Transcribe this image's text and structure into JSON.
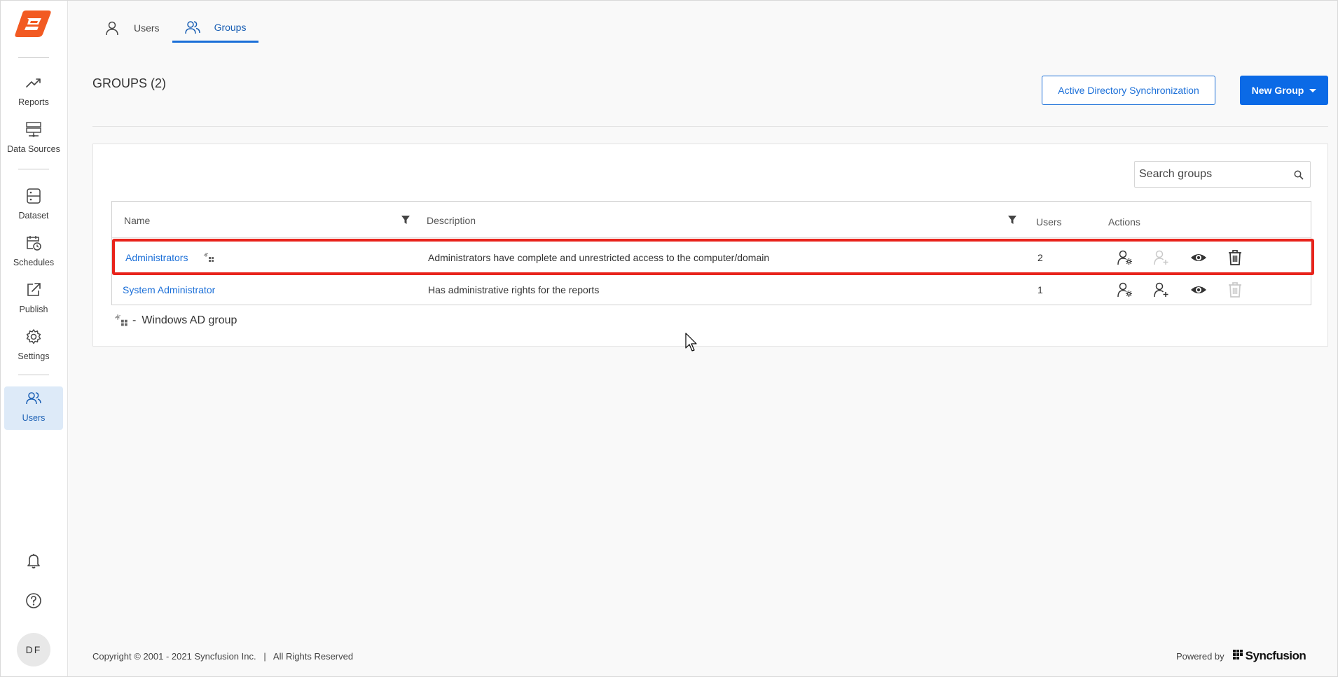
{
  "sidebar": {
    "items": [
      {
        "label": "Reports",
        "icon": "trend-icon"
      },
      {
        "label": "Data Sources",
        "icon": "database-icon"
      },
      {
        "label": "Dataset",
        "icon": "dataset-icon"
      },
      {
        "label": "Schedules",
        "icon": "calendar-clock-icon"
      },
      {
        "label": "Publish",
        "icon": "publish-icon"
      },
      {
        "label": "Settings",
        "icon": "gear-icon"
      },
      {
        "label": "Users",
        "icon": "users-icon",
        "active": true
      }
    ],
    "avatar_initials": "DF"
  },
  "tabs": [
    {
      "label": "Users",
      "icon": "user-icon"
    },
    {
      "label": "Groups",
      "icon": "groups-icon",
      "active": true
    }
  ],
  "page": {
    "title": "GROUPS (2)"
  },
  "buttons": {
    "ad_sync": "Active Directory Synchronization",
    "new_group": "New Group"
  },
  "search": {
    "placeholder": "Search groups"
  },
  "grid": {
    "columns": [
      "Name",
      "Description",
      "Users",
      "Actions"
    ],
    "rows": [
      {
        "name": "Administrators",
        "windows_ad": true,
        "description": "Administrators have complete and unrestricted access to the computer/domain",
        "users": "2",
        "add_user_enabled": false,
        "delete_enabled": true
      },
      {
        "name": "System Administrator",
        "windows_ad": false,
        "description": "Has administrative rights for the reports",
        "users": "1",
        "add_user_enabled": true,
        "delete_enabled": false
      }
    ]
  },
  "legend": {
    "separator": "-",
    "label": "Windows AD group"
  },
  "footer": {
    "copyright": "Copyright © 2001 - 2021 Syncfusion Inc.   |   All Rights Reserved",
    "powered_by": "Powered by",
    "brand": "Syncfusion"
  },
  "colors": {
    "accent": "#1b6fd8",
    "primary_button": "#0b6ae6",
    "highlight": "#e8231b",
    "logo": "#f25a22"
  }
}
